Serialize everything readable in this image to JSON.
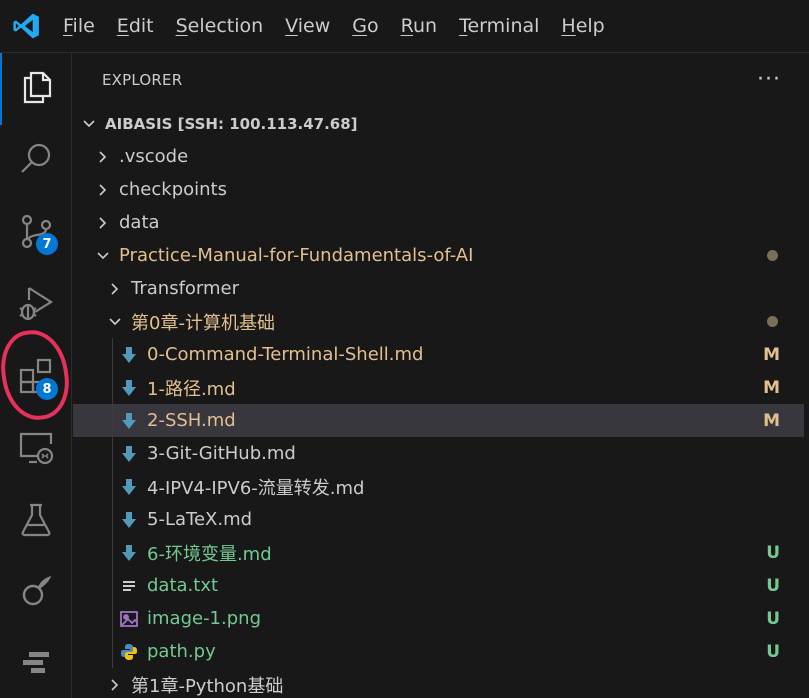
{
  "menu": [
    "File",
    "Edit",
    "Selection",
    "View",
    "Go",
    "Run",
    "Terminal",
    "Help"
  ],
  "menu_mnemonic": [
    "F",
    "E",
    "S",
    "V",
    "G",
    "R",
    "T",
    "H"
  ],
  "activity_bar": {
    "items": [
      {
        "icon": "files-icon",
        "active": true
      },
      {
        "icon": "search-icon"
      },
      {
        "icon": "source-control-icon",
        "badge": "7"
      },
      {
        "icon": "run-debug-icon"
      },
      {
        "icon": "extensions-icon",
        "badge": "8"
      },
      {
        "icon": "remote-explorer-icon"
      },
      {
        "icon": "testing-icon"
      },
      {
        "icon": "extension-custom-icon"
      },
      {
        "icon": "extension-custom-icon-2"
      }
    ],
    "annotation_color": "#e8305c"
  },
  "explorer": {
    "title": "EXPLORER",
    "more_label": "···",
    "root": "AIBASIS [SSH: 100.113.47.68]",
    "items": [
      {
        "label": ".vscode",
        "type": "folder",
        "expanded": false,
        "depth": 1,
        "color": "default"
      },
      {
        "label": "checkpoints",
        "type": "folder",
        "expanded": false,
        "depth": 1,
        "color": "default"
      },
      {
        "label": "data",
        "type": "folder",
        "expanded": false,
        "depth": 1,
        "color": "default"
      },
      {
        "label": "Practice-Manual-for-Fundamentals-of-AI",
        "type": "folder",
        "expanded": true,
        "depth": 1,
        "color": "mod",
        "dot": true
      },
      {
        "label": "Transformer",
        "type": "folder",
        "expanded": false,
        "depth": 2,
        "color": "default"
      },
      {
        "label": "第0章-计算机基础",
        "type": "folder",
        "expanded": true,
        "depth": 2,
        "color": "mod",
        "dot": true
      },
      {
        "label": "0-Command-Terminal-Shell.md",
        "type": "md",
        "depth": 3,
        "color": "mod",
        "status": "M"
      },
      {
        "label": "1-路径.md",
        "type": "md",
        "depth": 3,
        "color": "mod",
        "status": "M"
      },
      {
        "label": "2-SSH.md",
        "type": "md",
        "depth": 3,
        "color": "mod",
        "status": "M",
        "selected": true
      },
      {
        "label": "3-Git-GitHub.md",
        "type": "md",
        "depth": 3,
        "color": "default"
      },
      {
        "label": "4-IPV4-IPV6-流量转发.md",
        "type": "md",
        "depth": 3,
        "color": "default"
      },
      {
        "label": "5-LaTeX.md",
        "type": "md",
        "depth": 3,
        "color": "default"
      },
      {
        "label": "6-环境变量.md",
        "type": "md",
        "depth": 3,
        "color": "untracked",
        "status": "U"
      },
      {
        "label": "data.txt",
        "type": "txt",
        "depth": 3,
        "color": "untracked",
        "status": "U"
      },
      {
        "label": "image-1.png",
        "type": "png",
        "depth": 3,
        "color": "untracked",
        "status": "U"
      },
      {
        "label": "path.py",
        "type": "py",
        "depth": 3,
        "color": "untracked",
        "status": "U"
      },
      {
        "label": "第1章-Python基础",
        "type": "folder",
        "expanded": false,
        "depth": 2,
        "color": "default"
      }
    ]
  },
  "colors": {
    "accent": "#0078d4",
    "modified": "#e2c08d",
    "untracked": "#73c991",
    "selected_row": "#37373d",
    "markdown_icon": "#519aba",
    "image_icon": "#a074c4",
    "python_icon": "#4b8bbe"
  }
}
